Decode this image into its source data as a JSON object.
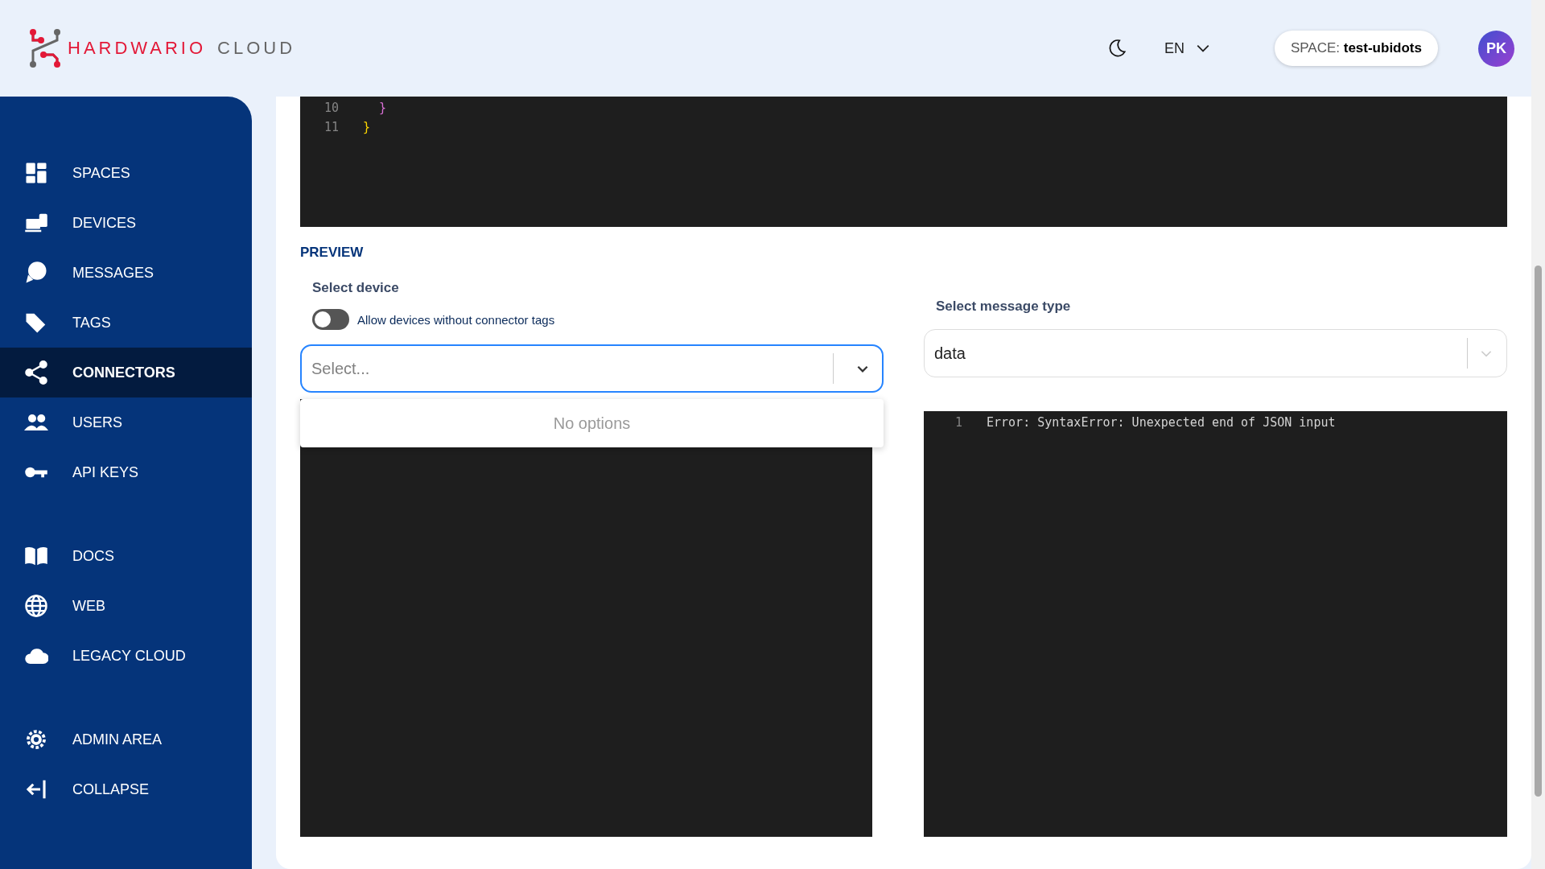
{
  "header": {
    "logo": {
      "brand": "HARDWARIO",
      "product": "CLOUD"
    },
    "language": "EN",
    "space": {
      "label": "SPACE:",
      "name": "test-ubidots"
    },
    "avatar": "PK"
  },
  "sidebar": {
    "groups": [
      [
        {
          "label": "SPACES",
          "kind": "spaces",
          "selected": false
        },
        {
          "label": "DEVICES",
          "kind": "devices",
          "selected": false
        },
        {
          "label": "MESSAGES",
          "kind": "messages",
          "selected": false
        },
        {
          "label": "TAGS",
          "kind": "tags",
          "selected": false
        },
        {
          "label": "CONNECTORS",
          "kind": "connectors",
          "selected": true
        },
        {
          "label": "USERS",
          "kind": "users",
          "selected": false
        },
        {
          "label": "API KEYS",
          "kind": "key",
          "selected": false
        }
      ],
      [
        {
          "label": "DOCS",
          "kind": "docs",
          "selected": false
        },
        {
          "label": "WEB",
          "kind": "web",
          "selected": false
        },
        {
          "label": "LEGACY CLOUD",
          "kind": "cloud",
          "selected": false
        }
      ],
      [
        {
          "label": "ADMIN AREA",
          "kind": "admin",
          "selected": false
        },
        {
          "label": "COLLAPSE",
          "kind": "collapse",
          "selected": false
        }
      ]
    ]
  },
  "code_editor": {
    "lines": [
      {
        "number": "10",
        "text": "}",
        "kind": "inner"
      },
      {
        "number": "11",
        "text": "}",
        "kind": "outer"
      }
    ]
  },
  "preview": {
    "title": "PREVIEW",
    "device": {
      "label": "Select device",
      "toggle": {
        "label": "Allow devices without connector tags",
        "on": false
      },
      "select": {
        "placeholder": "Select...",
        "focused": true
      },
      "dropdown": "No options"
    },
    "message_type": {
      "label": "Select message type",
      "select": {
        "value": "data"
      }
    },
    "output": {
      "lines": [
        {
          "number": "1",
          "text": "Error: SyntaxError: Unexpected end of JSON input"
        }
      ]
    }
  }
}
